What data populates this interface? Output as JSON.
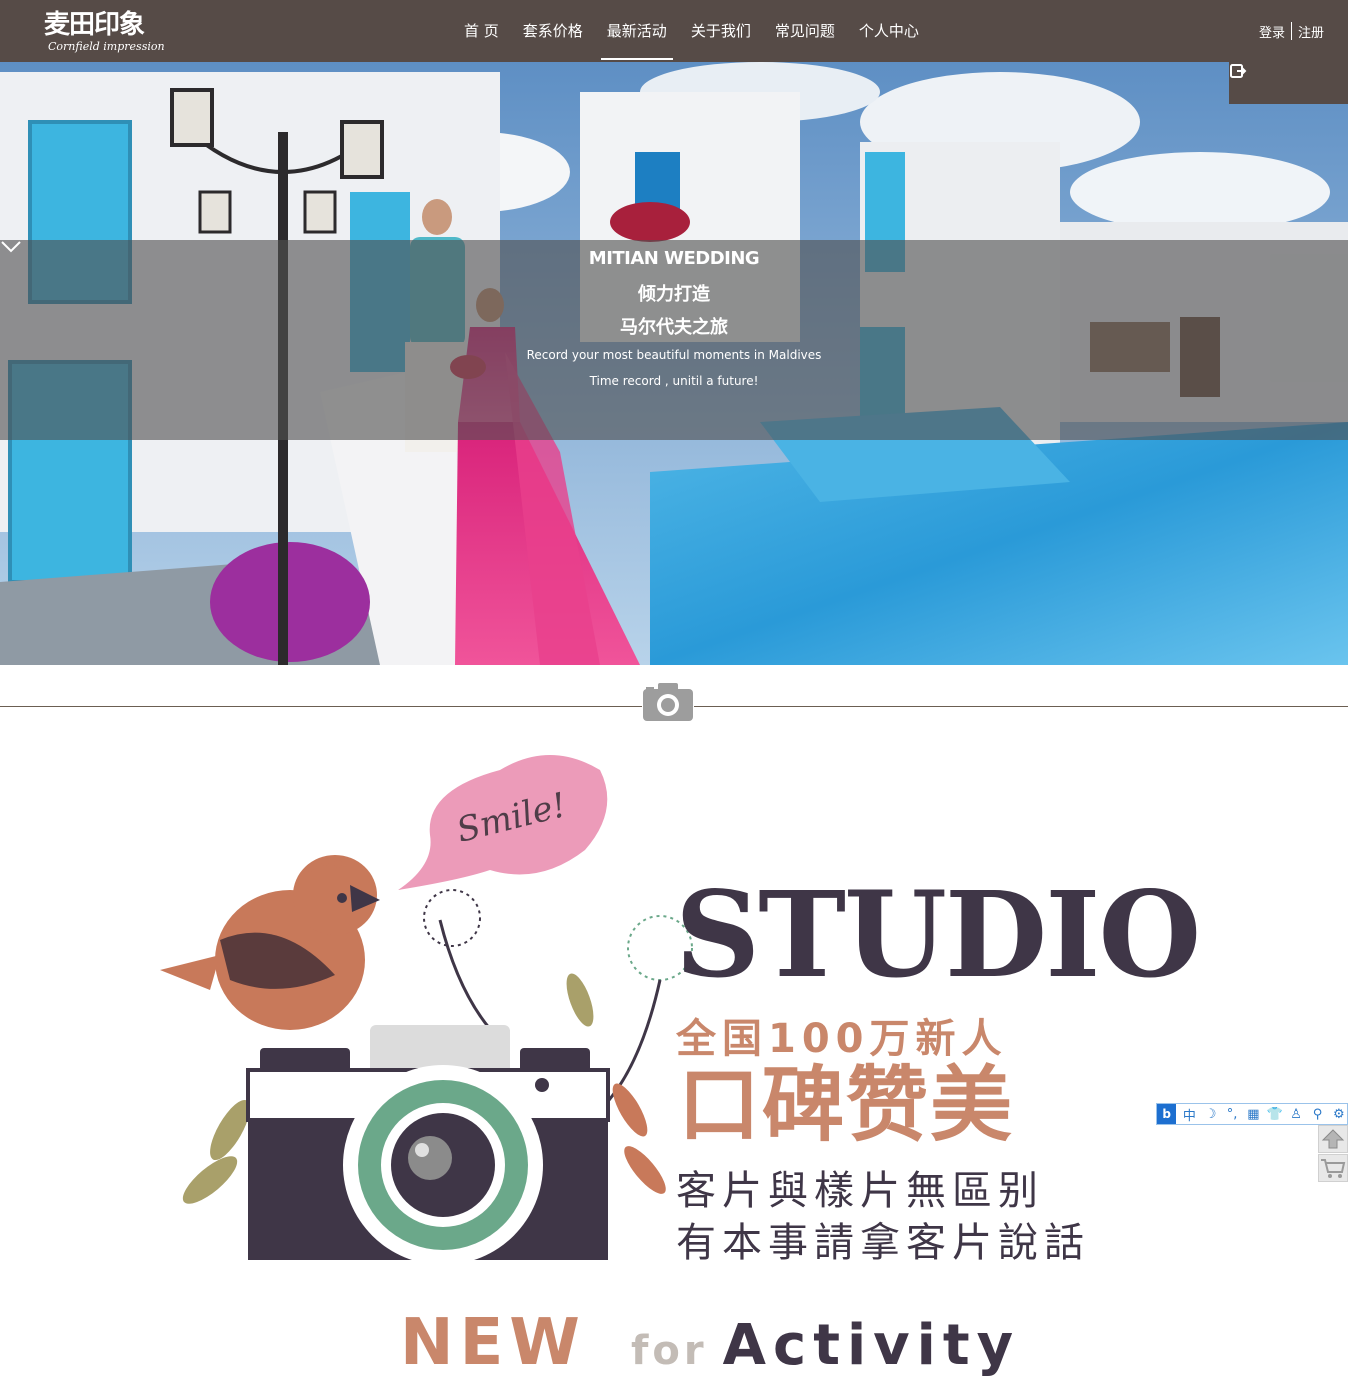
{
  "header": {
    "logo_cn": "麦田印象",
    "logo_en": "Cornfield impression",
    "nav": [
      "首 页",
      "套系价格",
      "最新活动",
      "关于我们",
      "常见问题",
      "个人中心"
    ],
    "active_index": 2,
    "login": "登录",
    "register": "注册"
  },
  "hero": {
    "title": "MITIAN WEDDING",
    "line2": "倾力打造",
    "line3": "马尔代夫之旅",
    "sub1": "Record your most beautiful moments in Maldives",
    "sub2": "Time record , unitil a future!"
  },
  "studio": {
    "speech": "Smile!",
    "big": "STUDIO",
    "line1": "全国100万新人",
    "line2": "口碑赞美",
    "line3": "客片與樣片無區别",
    "line4": "有本事請拿客片說話"
  },
  "activity": {
    "new": "NEW",
    "for": "for",
    "activity": "Activity"
  },
  "ime": {
    "logo": "b",
    "items": [
      "中",
      "☽",
      "°,",
      "▦",
      "👕",
      "♙",
      "⚲",
      "⚙"
    ]
  },
  "colors": {
    "nav_bg": "#564b47",
    "accent": "#c9876b",
    "dark_text": "#3f3647"
  }
}
